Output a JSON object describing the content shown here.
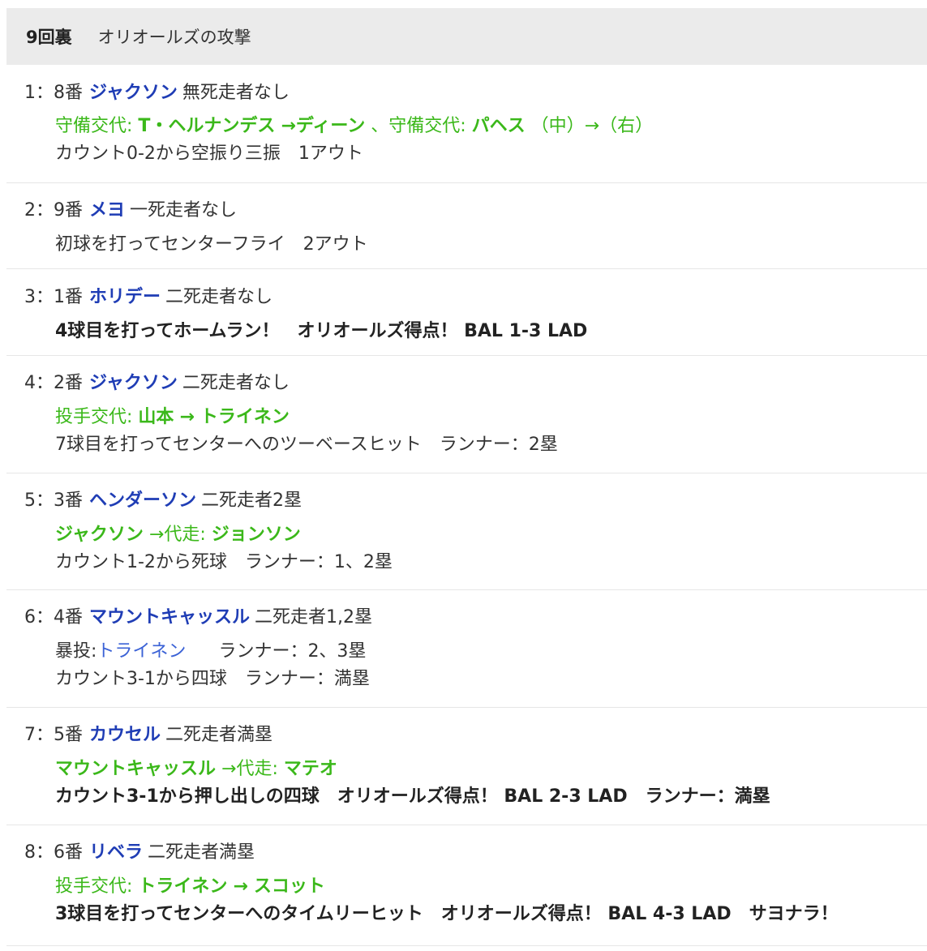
{
  "header": {
    "inning": "9回裏",
    "team_attack": "オリオールズの攻撃"
  },
  "plays": [
    {
      "order": "1：8番",
      "batter": "ジャクソン",
      "situation": "無死走者なし",
      "sub1": {
        "a": "守備交代:",
        "b": "T・ヘルナンデス",
        "c": "→ディーン",
        "d": "、守備交代:",
        "e": "パヘス",
        "f": "（中）→（右）"
      },
      "result": "カウント0-2から空振り三振　1アウト"
    },
    {
      "order": "2：9番",
      "batter": "メヨ",
      "situation": "一死走者なし",
      "result": "初球を打ってセンターフライ　2アウト"
    },
    {
      "order": "3：1番",
      "batter": "ホリデー",
      "situation": "二死走者なし",
      "result": "4球目を打ってホームラン！　オリオールズ得点！ BAL 1-3 LAD"
    },
    {
      "order": "4：2番",
      "batter": "ジャクソン",
      "situation": "二死走者なし",
      "sub1": {
        "a": "投手交代:",
        "b": "山本",
        "c": "→",
        "d": "トライネン"
      },
      "result": "7球目を打ってセンターへのツーベースヒット　ランナー：2塁"
    },
    {
      "order": "5：3番",
      "batter": "ヘンダーソン",
      "situation": "二死走者2塁",
      "sub1": {
        "a": "ジャクソン",
        "b": "→代走:",
        "c": "ジョンソン"
      },
      "result": "カウント1-2から死球　ランナー：1、2塁"
    },
    {
      "order": "6：4番",
      "batter": "マウントキャッスル",
      "situation": "二死走者1,2塁",
      "sub1": {
        "a": "暴投:",
        "b": "トライネン",
        "c": "ランナー：2、3塁"
      },
      "result": "カウント3-1から四球　ランナー：満塁"
    },
    {
      "order": "7：5番",
      "batter": "カウセル",
      "situation": "二死走者満塁",
      "sub1": {
        "a": "マウントキャッスル",
        "b": "→代走:",
        "c": "マテオ"
      },
      "result": "カウント3-1から押し出しの四球　オリオールズ得点！ BAL 2-3 LAD　ランナー：満塁"
    },
    {
      "order": "8：6番",
      "batter": "リベラ",
      "situation": "二死走者満塁",
      "sub1": {
        "a": "投手交代:",
        "b": "トライネン",
        "c": "→",
        "d": "スコット"
      },
      "result": "3球目を打ってセンターへのタイムリーヒット　オリオールズ得点！ BAL 4-3 LAD　サヨナラ！"
    }
  ],
  "colors": {
    "batter": "#1f3db5",
    "substitution": "#3bb81a",
    "link": "#3b62d6",
    "header_bg": "#ebebeb",
    "divider": "#e6e6e6"
  }
}
